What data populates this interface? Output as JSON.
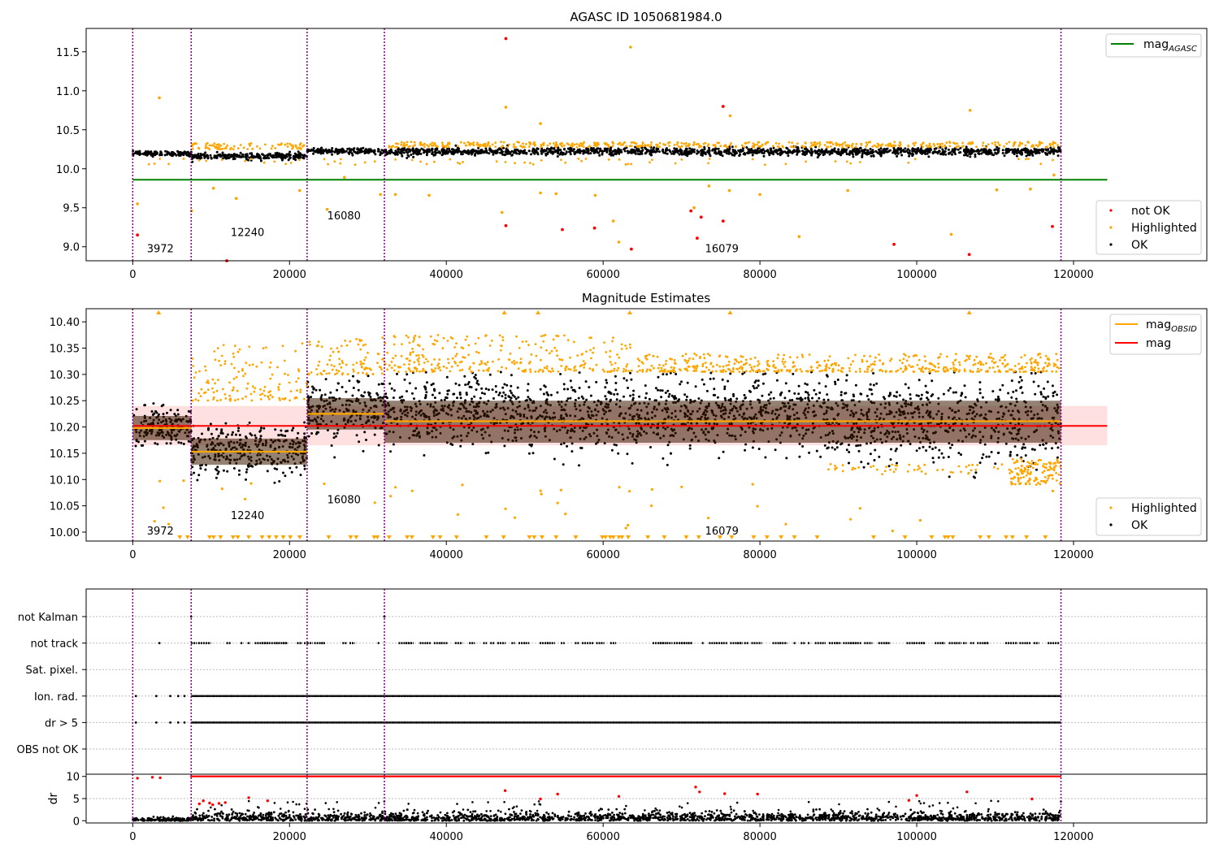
{
  "chart_data": [
    {
      "id": "panel1",
      "type": "scatter",
      "title": "AGASC ID 1050681984.0",
      "xlim": [
        -5944,
        137000
      ],
      "ylim": [
        8.82,
        11.8
      ],
      "x_ticks": [
        0,
        20000,
        40000,
        60000,
        80000,
        100000,
        120000
      ],
      "y_ticks": [
        9.0,
        9.5,
        10.0,
        10.5,
        11.0,
        11.5
      ],
      "y_tick_labels": [
        "9.0",
        "9.5",
        "10.0",
        "10.5",
        "11.0",
        "11.5"
      ],
      "obs_boundaries": [
        0,
        7450,
        22240,
        32100,
        118400
      ],
      "obs_labels": [
        {
          "text": "3972",
          "x": 1800,
          "y": 8.93
        },
        {
          "text": "12240",
          "x": 12500,
          "y": 9.14
        },
        {
          "text": "16080",
          "x": 24800,
          "y": 9.35
        },
        {
          "text": "16079",
          "x": 73000,
          "y": 8.93
        }
      ],
      "ok_band": [
        {
          "x0": 0,
          "x1": 7450,
          "center": 10.195,
          "halfwidth": 0.035
        },
        {
          "x0": 7450,
          "x1": 22240,
          "center": 10.16,
          "halfwidth": 0.045
        },
        {
          "x0": 22240,
          "x1": 32100,
          "center": 10.225,
          "halfwidth": 0.04
        },
        {
          "x0": 32100,
          "x1": 118400,
          "center": 10.22,
          "halfwidth": 0.055
        }
      ],
      "highlighted_band": [
        {
          "x0": 7450,
          "x1": 22240,
          "center": 10.29,
          "halfwidth": 0.04
        },
        {
          "x0": 32100,
          "x1": 118400,
          "center": 10.31,
          "halfwidth": 0.035
        }
      ],
      "lines": [
        {
          "name": "mag$_{AGASC}$",
          "y": 9.86,
          "x0": 0,
          "x1": 124300
        }
      ],
      "not_ok_points": [
        [
          600,
          9.15
        ],
        [
          47600,
          11.67
        ],
        [
          47600,
          9.27
        ],
        [
          54800,
          9.22
        ],
        [
          58900,
          9.24
        ],
        [
          63600,
          8.97
        ],
        [
          71200,
          9.46
        ],
        [
          72000,
          9.11
        ],
        [
          72500,
          9.38
        ],
        [
          75300,
          10.8
        ],
        [
          75300,
          9.33
        ],
        [
          97100,
          9.03
        ],
        [
          106700,
          8.9
        ],
        [
          117300,
          9.26
        ],
        [
          12000,
          8.82
        ]
      ],
      "highlighted_points": [
        [
          3400,
          10.91
        ],
        [
          47600,
          10.79
        ],
        [
          63500,
          11.56
        ],
        [
          52000,
          10.58
        ],
        [
          76200,
          10.68
        ],
        [
          106800,
          10.75
        ],
        [
          600,
          9.55
        ],
        [
          7500,
          9.46
        ],
        [
          10300,
          9.75
        ],
        [
          13200,
          9.62
        ],
        [
          21300,
          9.72
        ],
        [
          24800,
          9.48
        ],
        [
          27000,
          9.89
        ],
        [
          31600,
          9.67
        ],
        [
          33500,
          9.67
        ],
        [
          37800,
          9.66
        ],
        [
          47100,
          9.44
        ],
        [
          52000,
          9.69
        ],
        [
          54000,
          9.68
        ],
        [
          59000,
          9.66
        ],
        [
          61300,
          9.33
        ],
        [
          62000,
          9.06
        ],
        [
          71600,
          9.5
        ],
        [
          73500,
          9.78
        ],
        [
          76100,
          9.72
        ],
        [
          80000,
          9.67
        ],
        [
          85000,
          9.13
        ],
        [
          91200,
          9.72
        ],
        [
          104400,
          9.16
        ],
        [
          110200,
          9.73
        ],
        [
          114500,
          9.74
        ],
        [
          117500,
          9.92
        ]
      ],
      "legends": [
        {
          "position": "upper right",
          "entries": [
            {
              "label": "mag$_{AGASC}$",
              "color": "#008000",
              "kind": "line"
            }
          ]
        },
        {
          "position": "lower right",
          "entries": [
            {
              "label": "not OK",
              "color": "#ff0000",
              "kind": "dot"
            },
            {
              "label": "Highlighted",
              "color": "#ffa500",
              "kind": "dot"
            },
            {
              "label": "OK",
              "color": "#000000",
              "kind": "dot"
            }
          ]
        }
      ]
    },
    {
      "id": "panel2",
      "type": "scatter",
      "title": "Magnitude Estimates",
      "xlim": [
        -5944,
        137000
      ],
      "ylim": [
        9.983,
        10.425
      ],
      "x_ticks": [
        0,
        20000,
        40000,
        60000,
        80000,
        100000,
        120000
      ],
      "y_ticks": [
        10.0,
        10.05,
        10.1,
        10.15,
        10.2,
        10.25,
        10.3,
        10.35,
        10.4
      ],
      "y_tick_labels": [
        "10.00",
        "10.05",
        "10.10",
        "10.15",
        "10.20",
        "10.25",
        "10.30",
        "10.35",
        "10.40"
      ],
      "obs_boundaries": [
        0,
        7450,
        22240,
        32100,
        118400
      ],
      "obs_labels": [
        {
          "text": "3972",
          "x": 1800,
          "y": 9.995
        },
        {
          "text": "12240",
          "x": 12500,
          "y": 10.025
        },
        {
          "text": "16080",
          "x": 24800,
          "y": 10.055
        },
        {
          "text": "16079",
          "x": 73000,
          "y": 9.995
        }
      ],
      "mag_line": {
        "y": 10.202,
        "x0": 0,
        "x1": 124300,
        "band": [
          10.165,
          10.24
        ]
      },
      "mag_obsid": [
        {
          "x0": 0,
          "x1": 7450,
          "y": 10.198,
          "band": [
            10.175,
            10.221
          ]
        },
        {
          "x0": 7450,
          "x1": 22240,
          "y": 10.153,
          "band": [
            10.128,
            10.178
          ]
        },
        {
          "x0": 22240,
          "x1": 32100,
          "y": 10.225,
          "band": [
            10.195,
            10.255
          ]
        },
        {
          "x0": 32100,
          "x1": 118400,
          "y": 10.211,
          "band": [
            10.17,
            10.25
          ]
        }
      ],
      "ok_band": [
        {
          "x0": 0,
          "x1": 7450,
          "lo": 10.155,
          "hi": 10.245
        },
        {
          "x0": 7450,
          "x1": 22240,
          "lo": 10.1,
          "hi": 10.21
        },
        {
          "x0": 22240,
          "x1": 32100,
          "lo": 10.17,
          "hi": 10.3
        },
        {
          "x0": 32100,
          "x1": 60000,
          "lo": 10.15,
          "hi": 10.305
        },
        {
          "x0": 60000,
          "x1": 88000,
          "lo": 10.14,
          "hi": 10.305
        },
        {
          "x0": 88000,
          "x1": 118400,
          "lo": 10.12,
          "hi": 10.305
        }
      ],
      "highlighted_band": [
        {
          "x0": 7450,
          "x1": 22240,
          "lo": 10.25,
          "hi": 10.36
        },
        {
          "x0": 22240,
          "x1": 32100,
          "lo": 10.3,
          "hi": 10.37
        },
        {
          "x0": 32100,
          "x1": 64000,
          "lo": 10.305,
          "hi": 10.375
        },
        {
          "x0": 64000,
          "x1": 118400,
          "lo": 10.305,
          "hi": 10.34
        }
      ],
      "capped_points_bottom": [
        6000,
        7000,
        9800,
        10300,
        11200,
        12800,
        13400,
        14800,
        16500,
        17400,
        18300,
        19200,
        20100,
        21300,
        25000,
        27800,
        28500,
        30800,
        31200,
        32700,
        35000,
        35600,
        38300,
        39200,
        41300,
        45100,
        47300,
        50600,
        51200,
        52200,
        54000,
        56500,
        59900,
        60300,
        60900,
        61300,
        62000,
        62400,
        63200,
        65700,
        67800,
        70600,
        72200,
        74900,
        76400,
        79200,
        80900,
        82700,
        84400,
        87300,
        94500,
        98500,
        101900,
        103600,
        104000,
        104600,
        108100,
        109200,
        111400,
        112200,
        114000,
        116400
      ],
      "capped_points_top": [
        3300,
        47400,
        51700,
        63400,
        76200,
        106700
      ],
      "legends": [
        {
          "position": "upper right",
          "entries": [
            {
              "label": "mag$_{OBSID}$",
              "color": "#ffa500",
              "kind": "line"
            },
            {
              "label": "mag",
              "color": "#ff0000",
              "kind": "line"
            }
          ]
        },
        {
          "position": "lower right",
          "entries": [
            {
              "label": "Highlighted",
              "color": "#ffa500",
              "kind": "dot"
            },
            {
              "label": "OK",
              "color": "#000000",
              "kind": "dot"
            }
          ]
        }
      ]
    },
    {
      "id": "panel3",
      "type": "scatter",
      "xlim": [
        -5944,
        137000
      ],
      "flag_rows": [
        "not Kalman",
        "not track",
        "Sat. pixel.",
        "Ion. rad.",
        "dr > 5",
        "OBS not OK"
      ],
      "obs_boundaries": [
        0,
        7450,
        22240,
        32100,
        118400
      ],
      "flag_segments": [
        {
          "row": "not track",
          "ranges": [
            [
              7450,
              22240
            ],
            [
              22240,
              32100
            ],
            [
              32100,
              118400
            ]
          ],
          "density": "sparse"
        },
        {
          "row": "Ion. rad.",
          "ranges": [
            [
              7450,
              118400
            ]
          ],
          "density": "dense"
        },
        {
          "row": "dr > 5",
          "ranges": [
            [
              7450,
              118400
            ]
          ],
          "density": "dense"
        }
      ],
      "flag_points_sparse": [
        {
          "row": "not track",
          "x": [
            3400
          ]
        },
        {
          "row": "not Kalman",
          "x": [
            7450,
            32100
          ]
        },
        {
          "row": "Ion. rad.",
          "x": [
            400,
            3000,
            4800,
            5800,
            6600
          ]
        },
        {
          "row": "dr > 5",
          "x": [
            400,
            3000,
            4800,
            5800,
            6600
          ]
        }
      ]
    },
    {
      "id": "panel4",
      "type": "scatter",
      "ylabel": "dr",
      "xlim": [
        -5944,
        137000
      ],
      "ylim": [
        -0.5,
        10.5
      ],
      "x_ticks": [
        0,
        20000,
        40000,
        60000,
        80000,
        100000,
        120000
      ],
      "y_ticks": [
        0,
        5,
        10
      ],
      "y_tick_labels": [
        "0",
        "5",
        "10"
      ],
      "obs_boundaries": [
        0,
        7450,
        22240,
        32100,
        118400
      ],
      "ok_band": [
        {
          "x0": 0,
          "x1": 7450,
          "lo": 0.0,
          "hi": 0.8
        },
        {
          "x0": 7450,
          "x1": 32100,
          "lo": 0.0,
          "hi": 2.0
        },
        {
          "x0": 32100,
          "x1": 118400,
          "lo": 0.0,
          "hi": 2.0
        }
      ],
      "capped_row": {
        "y": 10,
        "x0": 7450,
        "x1": 118400
      },
      "red_points": [
        [
          600,
          9.6
        ],
        [
          2500,
          9.8
        ],
        [
          3500,
          9.7
        ],
        [
          8500,
          3.8
        ],
        [
          9000,
          4.5
        ],
        [
          9800,
          4.0
        ],
        [
          10200,
          3.6
        ],
        [
          11000,
          3.9
        ],
        [
          11800,
          4.1
        ],
        [
          14800,
          5.2
        ],
        [
          17200,
          4.5
        ],
        [
          47500,
          6.8
        ],
        [
          52000,
          4.9
        ],
        [
          54200,
          6.0
        ],
        [
          62000,
          5.5
        ],
        [
          71800,
          7.6
        ],
        [
          72300,
          6.5
        ],
        [
          75500,
          6.1
        ],
        [
          79700,
          6.0
        ],
        [
          99000,
          4.6
        ],
        [
          100000,
          5.7
        ],
        [
          106400,
          6.5
        ],
        [
          114700,
          4.9
        ]
      ]
    }
  ]
}
